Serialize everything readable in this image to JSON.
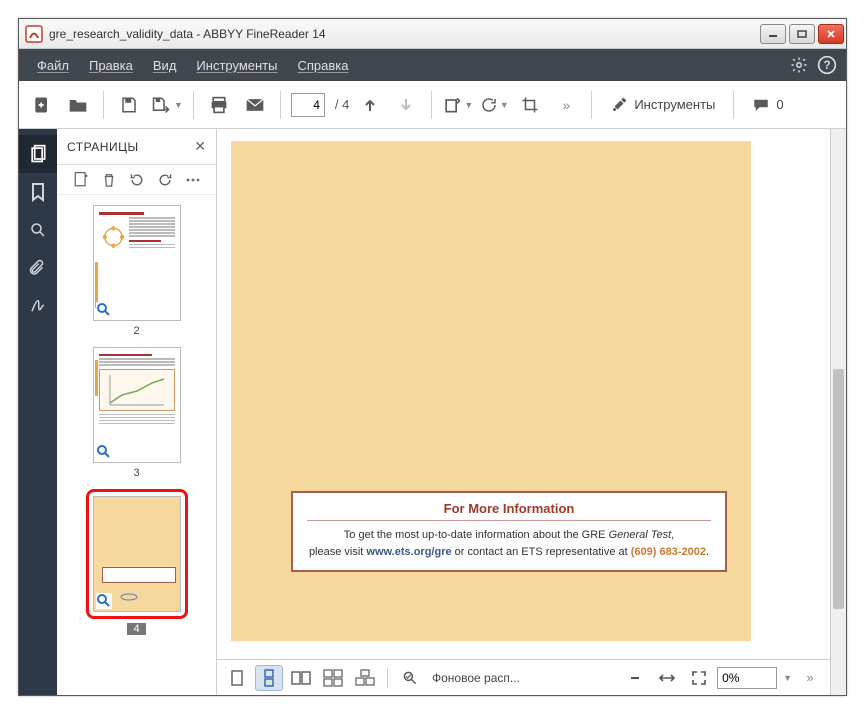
{
  "window": {
    "title": "gre_research_validity_data - ABBYY FineReader 14"
  },
  "menu": {
    "file": "Файл",
    "edit": "Правка",
    "view": "Вид",
    "tools": "Инструменты",
    "help": "Справка"
  },
  "toolbar": {
    "page_current": "4",
    "page_total": "/ 4",
    "tools_label": "Инструменты",
    "comments_count": "0"
  },
  "pages_panel": {
    "title": "СТРАНИЦЫ",
    "thumbs": [
      {
        "label": "2"
      },
      {
        "label": "3"
      },
      {
        "label": "4",
        "selected": true
      }
    ]
  },
  "document": {
    "infobox": {
      "title": "For More Information",
      "line1_a": "To get the most up-to-date information about the GRE ",
      "line1_b": "General Test",
      "line1_c": ",",
      "line2_a": "please visit ",
      "line2_b": "www.ets.org/gre",
      "line2_c": " or contact an ETS representative at ",
      "line2_d": "(609) 683-2002",
      "line2_e": "."
    }
  },
  "bottombar": {
    "bg_label": "Фоновое расп...",
    "zoom": "0%"
  }
}
